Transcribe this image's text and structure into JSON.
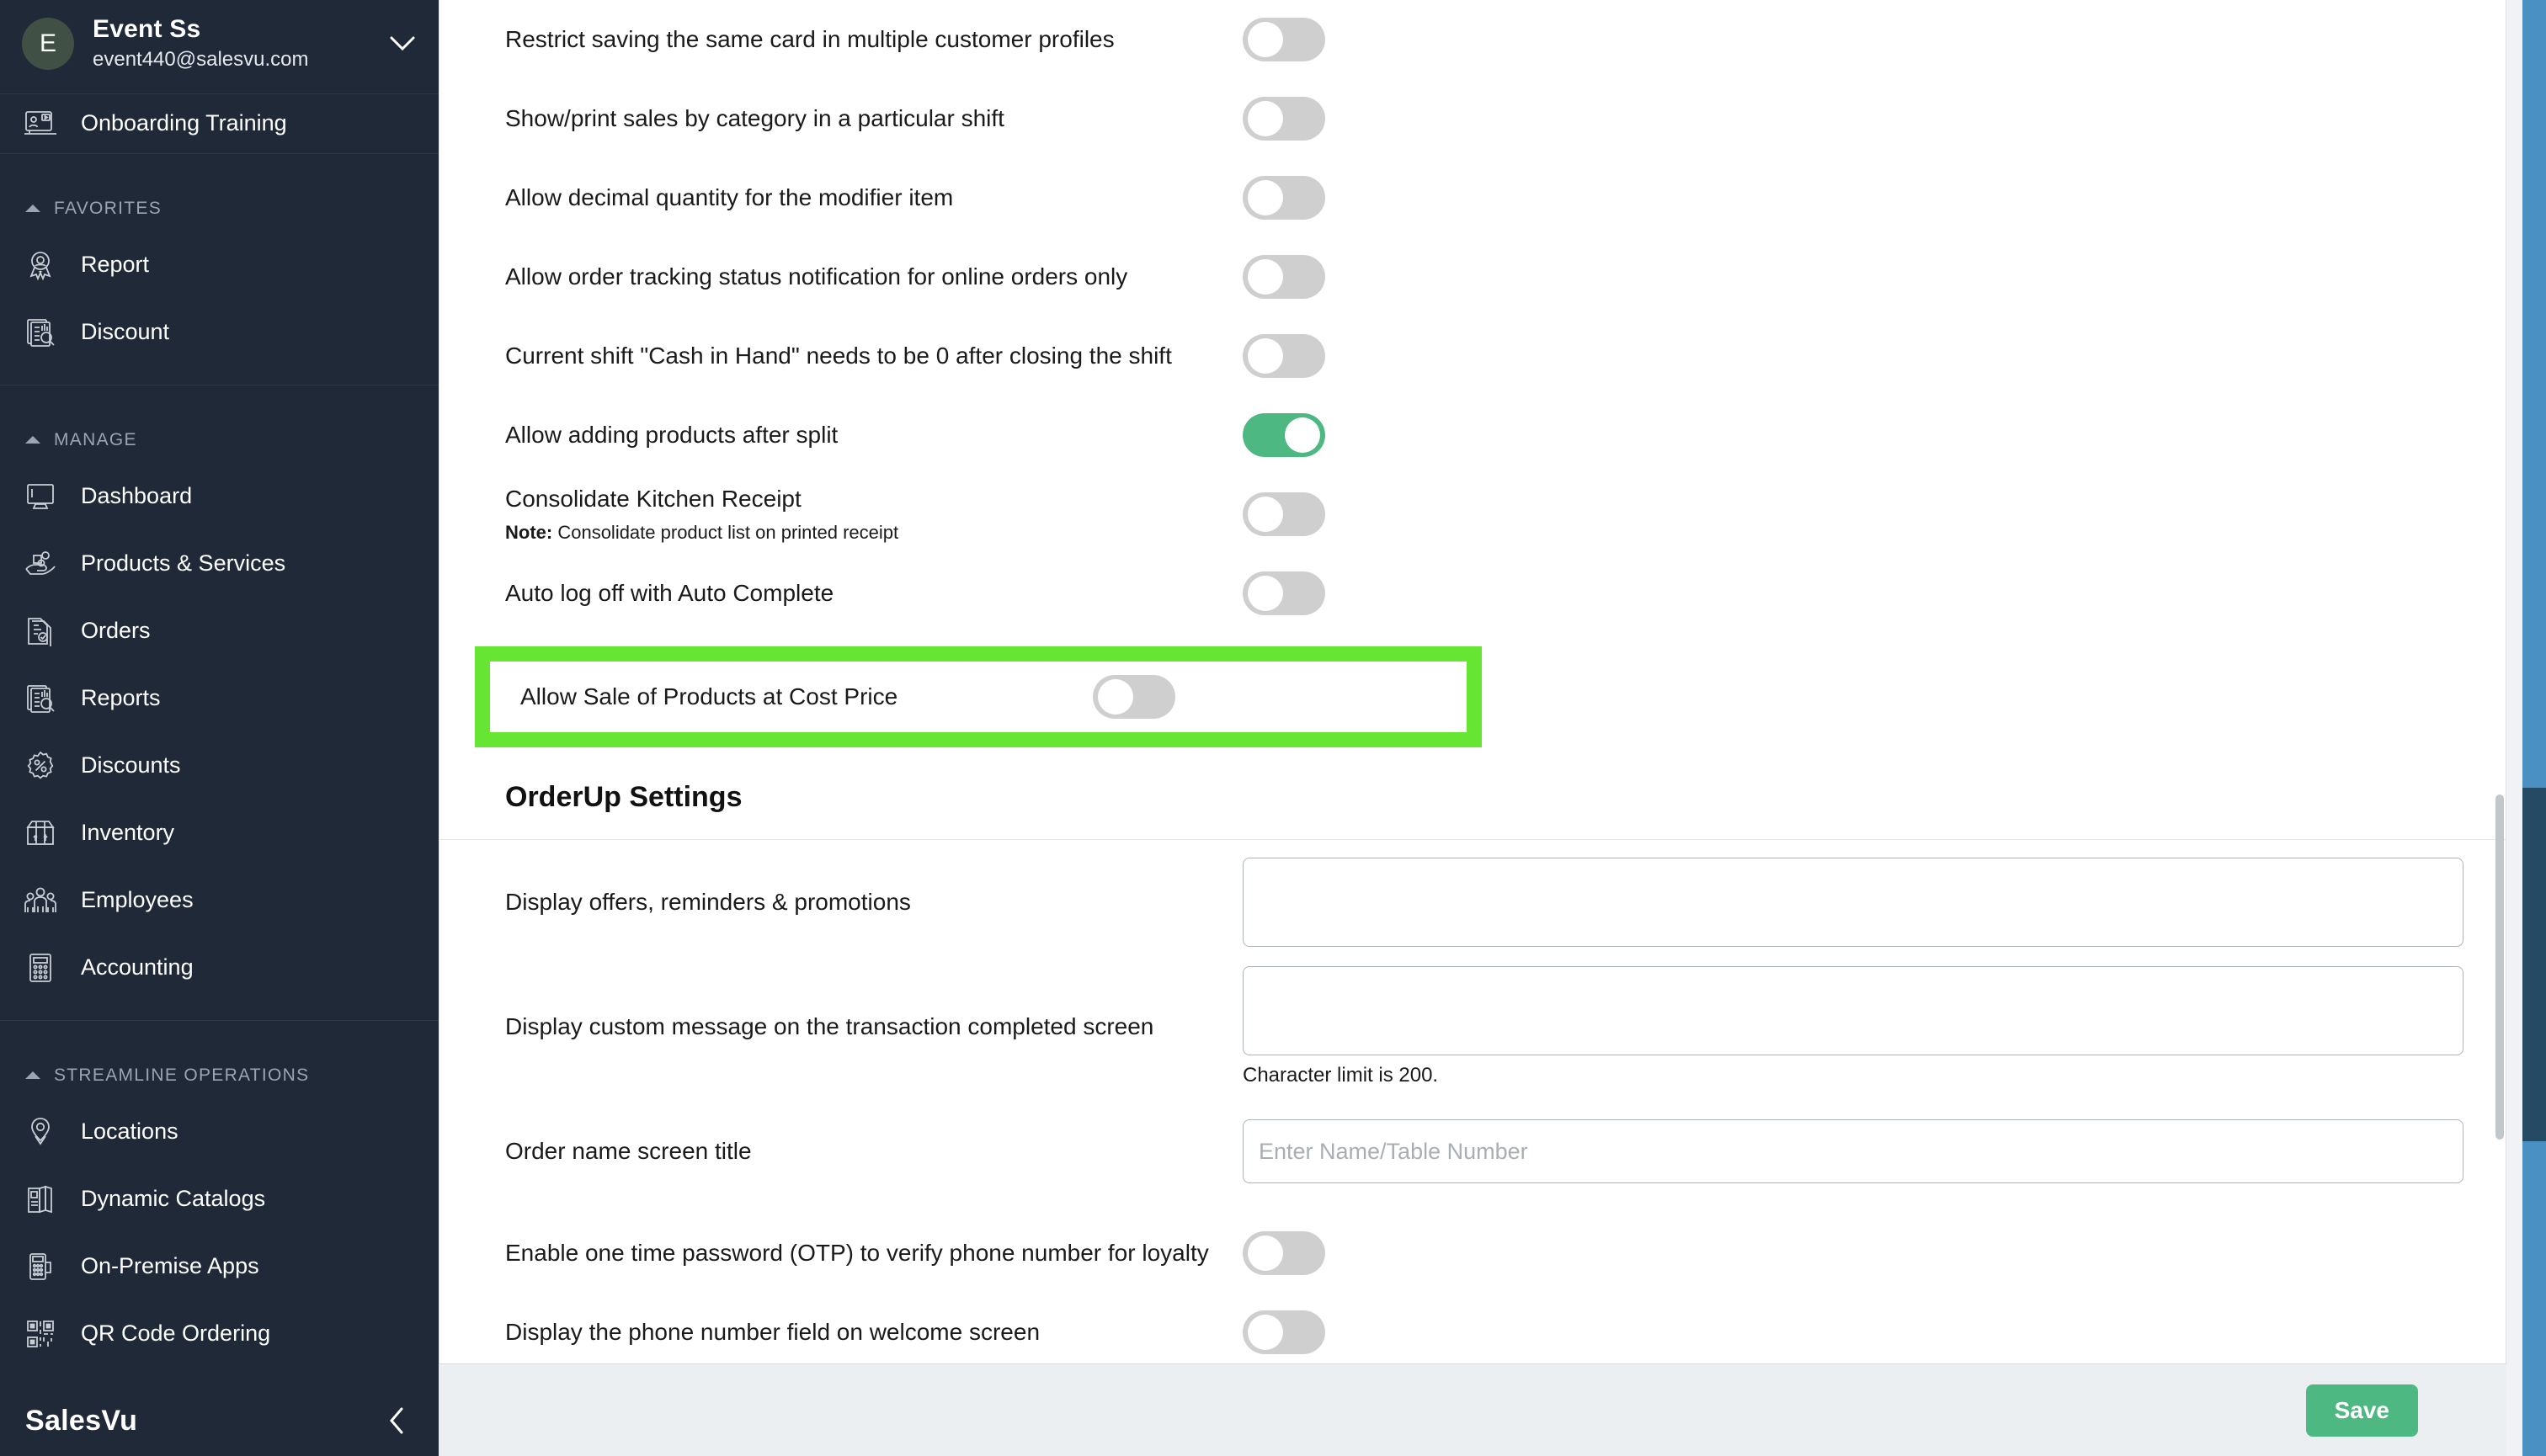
{
  "sidebar": {
    "account": {
      "initial": "E",
      "name": "Event Ss",
      "email": "event440@salesvu.com",
      "chevron_icon": "chevron-down-icon"
    },
    "onboarding": {
      "label": "Onboarding Training",
      "icon": "training-screen-icon"
    },
    "sections": [
      {
        "title": "FAVORITES",
        "items": [
          {
            "label": "Report",
            "icon": "award-report-icon"
          },
          {
            "label": "Discount",
            "icon": "discount-search-icon"
          }
        ]
      },
      {
        "title": "MANAGE",
        "items": [
          {
            "label": "Dashboard",
            "icon": "monitor-icon"
          },
          {
            "label": "Products & Services",
            "icon": "products-hand-icon"
          },
          {
            "label": "Orders",
            "icon": "order-document-icon"
          },
          {
            "label": "Reports",
            "icon": "reports-search-icon"
          },
          {
            "label": "Discounts",
            "icon": "percent-badge-icon"
          },
          {
            "label": "Inventory",
            "icon": "inventory-box-icon"
          },
          {
            "label": "Employees",
            "icon": "employees-group-icon"
          },
          {
            "label": "Accounting",
            "icon": "calculator-icon"
          }
        ]
      },
      {
        "title": "STREAMLINE OPERATIONS",
        "items": [
          {
            "label": "Locations",
            "icon": "map-pin-icon"
          },
          {
            "label": "Dynamic Catalogs",
            "icon": "catalog-book-icon"
          },
          {
            "label": "On-Premise Apps",
            "icon": "pos-terminal-icon"
          },
          {
            "label": "QR Code Ordering",
            "icon": "qr-code-icon"
          }
        ]
      }
    ],
    "footer": {
      "brand": "SalesVu",
      "collapse_icon": "chevron-left-icon"
    }
  },
  "main": {
    "toggle_rows": [
      {
        "label": "Restrict saving the same card in multiple customer profiles",
        "state": "off"
      },
      {
        "label": "Show/print sales by category in a particular shift",
        "state": "off"
      },
      {
        "label": "Allow decimal quantity for the modifier item",
        "state": "off"
      },
      {
        "label": "Allow order tracking status notification for online orders only",
        "state": "off"
      },
      {
        "label": "Current shift \"Cash in Hand\" needs to be 0 after closing the shift",
        "state": "off"
      },
      {
        "label": "Allow adding products after split",
        "state": "on"
      },
      {
        "label": "Consolidate Kitchen Receipt",
        "note_bold": "Note:",
        "note": " Consolidate product list on printed receipt",
        "state": "off"
      },
      {
        "label": "Auto log off with Auto Complete",
        "state": "off"
      }
    ],
    "highlighted_row": {
      "label": "Allow Sale of Products at Cost Price",
      "state": "off",
      "highlight_color": "#66e533"
    },
    "orderup": {
      "section_title": "OrderUp Settings",
      "offers_label": "Display offers, reminders & promotions",
      "offers_value": "",
      "offers_placeholder": "",
      "custom_msg_label": "Display custom message on the transaction completed screen",
      "custom_msg_value": "",
      "custom_msg_placeholder": "",
      "custom_msg_hint": "Character limit is 200.",
      "order_title_label": "Order name screen title",
      "order_title_value": "",
      "order_title_placeholder": "Enter Name/Table Number",
      "otp_label": "Enable one time password (OTP) to verify phone number for loyalty",
      "otp_state": "off",
      "phone_label": "Display the phone number field on welcome screen",
      "phone_state": "off"
    },
    "save_label": "Save"
  },
  "colors": {
    "sidebar_bg": "#1f2937",
    "toggle_on": "#4eb882",
    "toggle_off": "#cfcfcf",
    "highlight": "#66e533",
    "save_button": "#4eb882",
    "scrollbar_track": "#4a90c2",
    "scrollbar_thumb": "#254a63"
  }
}
